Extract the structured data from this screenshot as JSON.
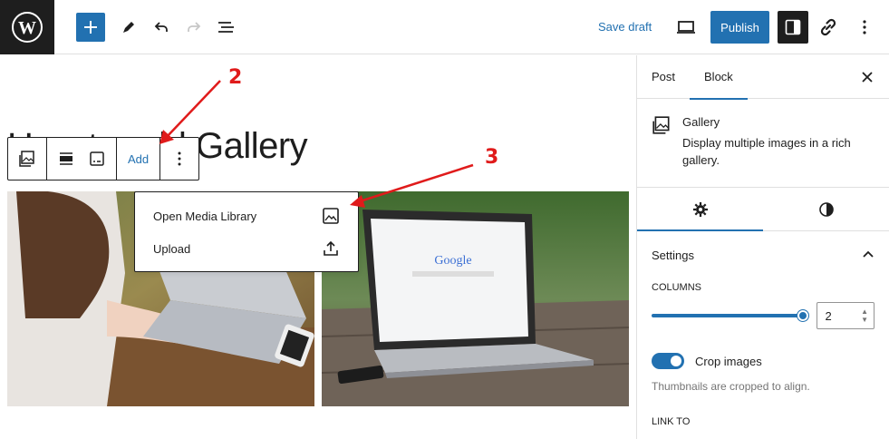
{
  "toolbar": {
    "save_draft": "Save draft",
    "publish": "Publish"
  },
  "editor": {
    "title": "How to add Gallery",
    "block_toolbar": {
      "add_label": "Add"
    },
    "add_menu": [
      {
        "label": "Open Media Library",
        "icon": "image-icon"
      },
      {
        "label": "Upload",
        "icon": "upload-icon"
      }
    ]
  },
  "annotations": {
    "step2": "2",
    "step3": "3"
  },
  "sidebar": {
    "tabs": [
      "Post",
      "Block"
    ],
    "active_tab": "Block",
    "block": {
      "name": "Gallery",
      "description": "Display multiple images in a rich gallery."
    },
    "settings_label": "Settings",
    "columns_label": "COLUMNS",
    "columns_value": "2",
    "crop_label": "Crop images",
    "crop_enabled": true,
    "crop_help": "Thumbnails are cropped to align.",
    "link_to_label": "LINK TO"
  },
  "colors": {
    "accent": "#2271b1",
    "dark": "#1e1e1e",
    "annotation": "#e01b1b"
  }
}
